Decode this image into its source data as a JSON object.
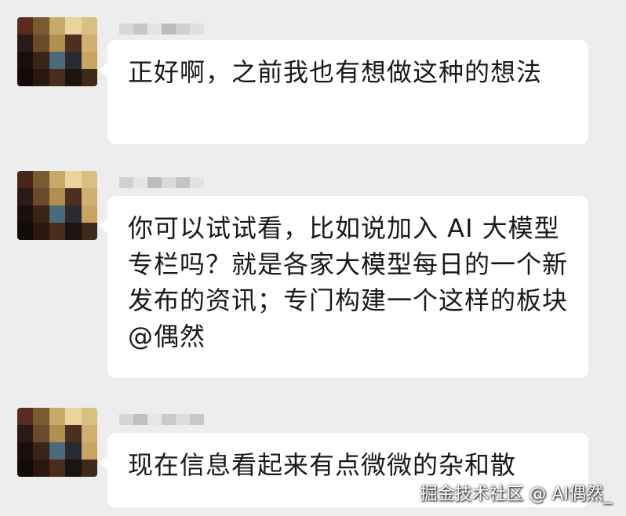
{
  "messages": [
    {
      "text": "正好啊，之前我也有想做这种的想法"
    },
    {
      "text": "你可以试试看，比如说加入 AI 大模型专栏吗？就是各家大模型每日的一个新发布的资讯；专门构建一个这样的板块@偶然"
    },
    {
      "text": "现在信息看起来有点微微的杂和散"
    }
  ],
  "watermark": "掘金技术社区 @ AI偶然_"
}
